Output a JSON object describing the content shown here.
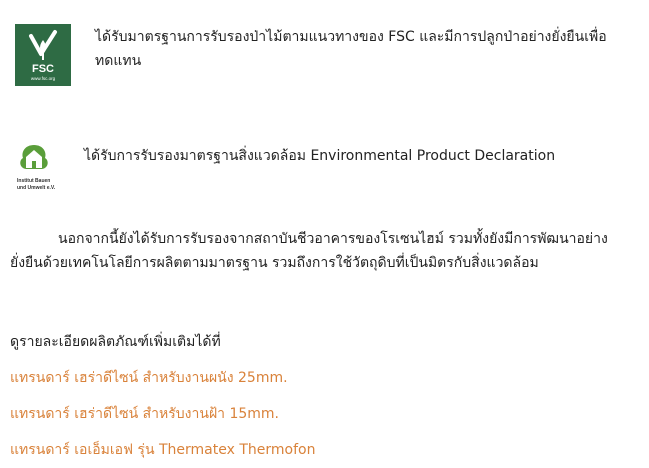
{
  "certifications": [
    {
      "logo_icon": "fsc-logo-icon",
      "logo_text": "FSC",
      "logo_url_text": "www.fsc.org",
      "text_line1": "ได้รับมาตรฐานการรับรองป่าไม้ตามแนวทางของ FSC และมีการปลูกป่าอย่างยั่งยืนเพื่อ",
      "text_line2": "ทดแทน"
    },
    {
      "logo_icon": "institut-bauen-und-umwelt-logo-icon",
      "logo_text_line1": "Institut Bauen",
      "logo_text_line2": "und Umwelt e.V.",
      "text": "ได้รับการรับรองมาตรฐานสิ่งแวดล้อม Environmental Product Declaration"
    }
  ],
  "paragraph": {
    "line1": "นอกจากนี้ยังได้รับการรับรองจากสถาบันชีวอาคารของโรเซนไฮม์ รวมทั้งยังมีการพัฒนาอย่าง",
    "line2": "ยั่งยืนด้วยเทคโนโลยีการผลิตตามมาตรฐาน รวมถึงการใช้วัตถุดิบที่เป็นมิตรกับสิ่งแวดล้อม"
  },
  "more_info_label": "ดูรายละเอียดผลิตภัณฑ์เพิ่มเติมได้ที่",
  "product_links": [
    "แทรนดาร์ เฮร่าดีไซน์ สำหรับงานผนัง 25mm.",
    "แทรนดาร์ เฮร่าดีไซน์ สำหรับงานฝ้า 15mm.",
    "แทรนดาร์ เอเอ็มเอฟ รุ่น Thermatex Thermofon"
  ],
  "colors": {
    "text": "#222222",
    "link": "#d9823a",
    "fsc_green": "#2e6b44",
    "ibu_green": "#5a9e3a"
  }
}
